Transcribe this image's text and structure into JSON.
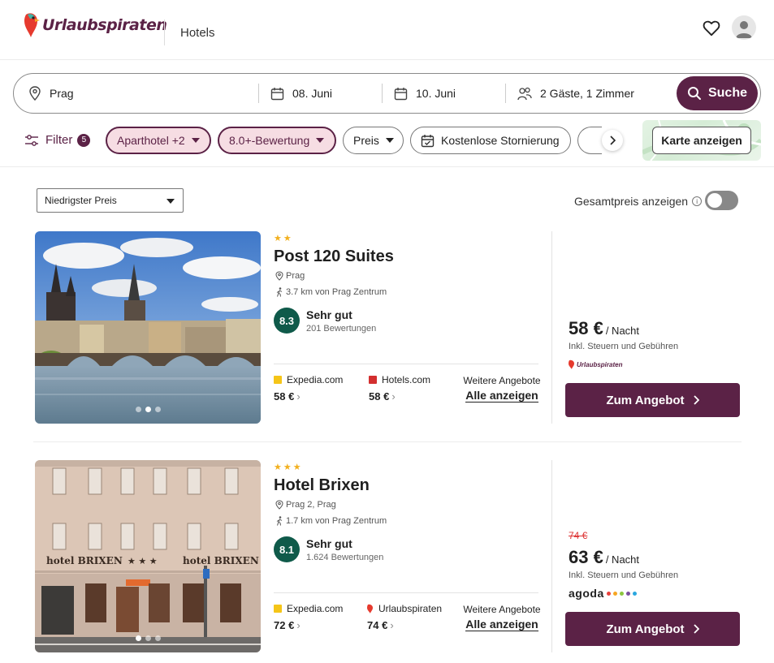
{
  "header": {
    "brand": "Urlaubspiraten",
    "section": "Hotels"
  },
  "search": {
    "destination": "Prag",
    "checkin": "08. Juni",
    "checkout": "10. Juni",
    "guests": "2 Gäste, 1 Zimmer",
    "button": "Suche"
  },
  "filters": {
    "filter_label": "Filter",
    "filter_count": "5",
    "chips": [
      "Aparthotel +2",
      "8.0+-Bewertung",
      "Preis",
      "Kostenlose Stornierung"
    ],
    "map_button": "Karte anzeigen"
  },
  "sort": {
    "selected": "Niedrigster Preis",
    "total_price_label": "Gesamtpreis anzeigen"
  },
  "hotels": [
    {
      "name": "Post 120 Suites",
      "stars": "★★",
      "location": "Prag",
      "distance": "3.7 km von Prag Zentrum",
      "score": "8.3",
      "score_label": "Sehr gut",
      "review_count": "201 Bewertungen",
      "offers": [
        {
          "provider": "Expedia.com",
          "price": "58 €"
        },
        {
          "provider": "Hotels.com",
          "price": "58 €"
        }
      ],
      "more_label": "Weitere Angebote",
      "more_link": "Alle anzeigen",
      "price": "58 €",
      "per_night": "/ Nacht",
      "price_note": "Inkl. Steuern und Gebühren",
      "source": "Urlaubspiraten",
      "cta": "Zum Angebot"
    },
    {
      "name": "Hotel Brixen",
      "stars": "★★★",
      "location": "Prag 2, Prag",
      "distance": "1.7 km von Prag Zentrum",
      "score": "8.1",
      "score_label": "Sehr gut",
      "review_count": "1.624 Bewertungen",
      "offers": [
        {
          "provider": "Expedia.com",
          "price": "72 €"
        },
        {
          "provider": "Urlaubspiraten",
          "price": "74 €"
        }
      ],
      "more_label": "Weitere Angebote",
      "more_link": "Alle anzeigen",
      "old_price": "74 €",
      "price": "63 €",
      "per_night": "/ Nacht",
      "price_note": "Inkl. Steuern und Gebühren",
      "source": "agoda",
      "cta": "Zum Angebot",
      "facade_sign": "hotel BRIXEN"
    }
  ],
  "colors": {
    "brand": "#5b2246",
    "score": "#0f5a4a",
    "stars": "#f2b01e",
    "strike": "#dd3333"
  }
}
